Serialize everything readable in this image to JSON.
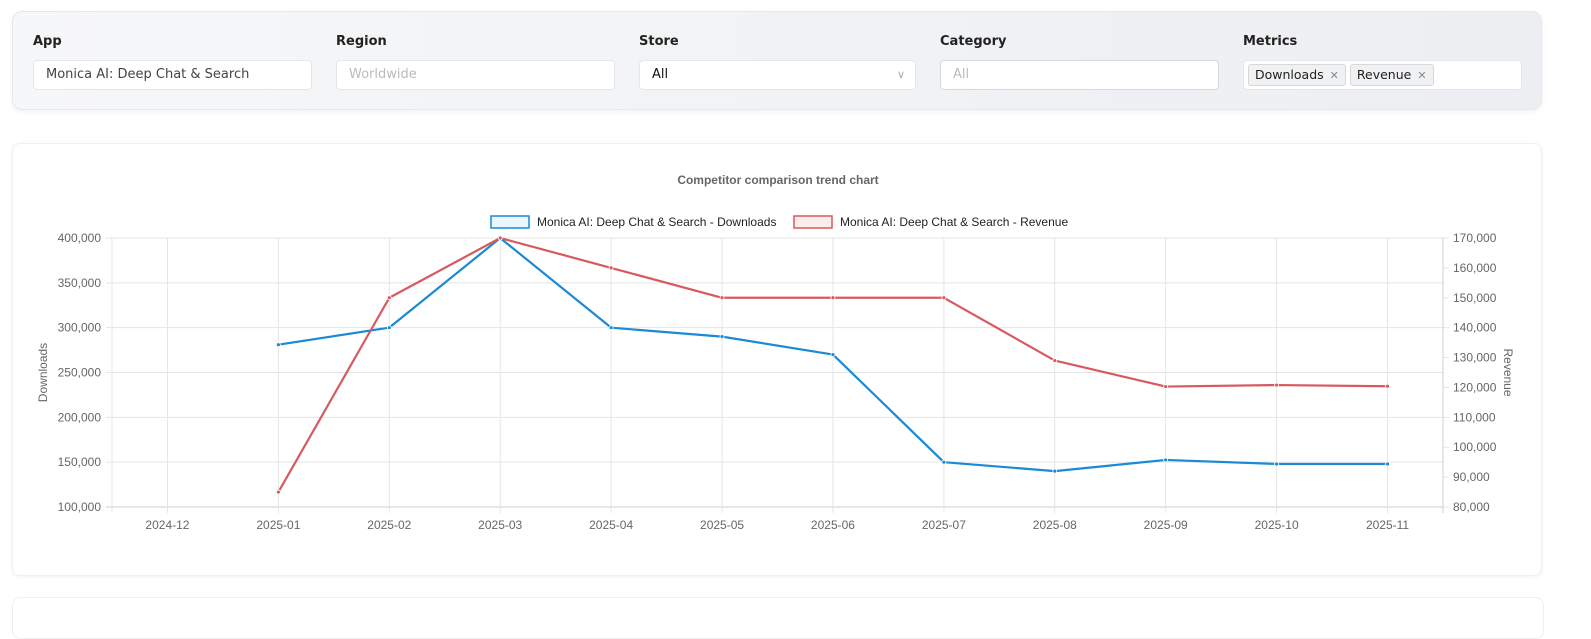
{
  "filters": {
    "app": {
      "label": "App",
      "value": "Monica AI: Deep Chat & Search"
    },
    "region": {
      "label": "Region",
      "placeholder": "Worldwide"
    },
    "store": {
      "label": "Store",
      "value": "All"
    },
    "category": {
      "label": "Category",
      "placeholder": "All"
    },
    "metrics": {
      "label": "Metrics",
      "tags": [
        "Downloads",
        "Revenue"
      ]
    }
  },
  "chart_data": {
    "type": "line",
    "title": "Competitor comparison trend chart",
    "categories": [
      "2024-12",
      "2025-01",
      "2025-02",
      "2025-03",
      "2025-04",
      "2025-05",
      "2025-06",
      "2025-07",
      "2025-08",
      "2025-09",
      "2025-10",
      "2025-11"
    ],
    "series": [
      {
        "name": "Monica AI: Deep Chat & Search - Downloads",
        "axis": "left",
        "color": "#1a8ad4",
        "values": [
          null,
          281000,
          300000,
          400000,
          300000,
          290000,
          270000,
          150000,
          140000,
          152500,
          148000,
          148000
        ]
      },
      {
        "name": "Monica AI: Deep Chat & Search - Revenue",
        "axis": "right",
        "color": "#d65a5f",
        "values": [
          null,
          85000,
          150000,
          170000,
          160000,
          150000,
          150000,
          150000,
          129000,
          120300,
          120800,
          120400
        ]
      }
    ],
    "y_left": {
      "label": "Downloads",
      "range": [
        100000,
        400000
      ],
      "ticks": [
        "400,000",
        "350,000",
        "300,000",
        "250,000",
        "200,000",
        "150,000",
        "100,000"
      ]
    },
    "y_right": {
      "label": "Revenue",
      "range": [
        80000,
        170000
      ],
      "ticks": [
        "170,000",
        "160,000",
        "150,000",
        "140,000",
        "130,000",
        "120,000",
        "110,000",
        "100,000",
        "90,000",
        "80,000"
      ]
    },
    "grid": true,
    "legend": "top-center"
  }
}
